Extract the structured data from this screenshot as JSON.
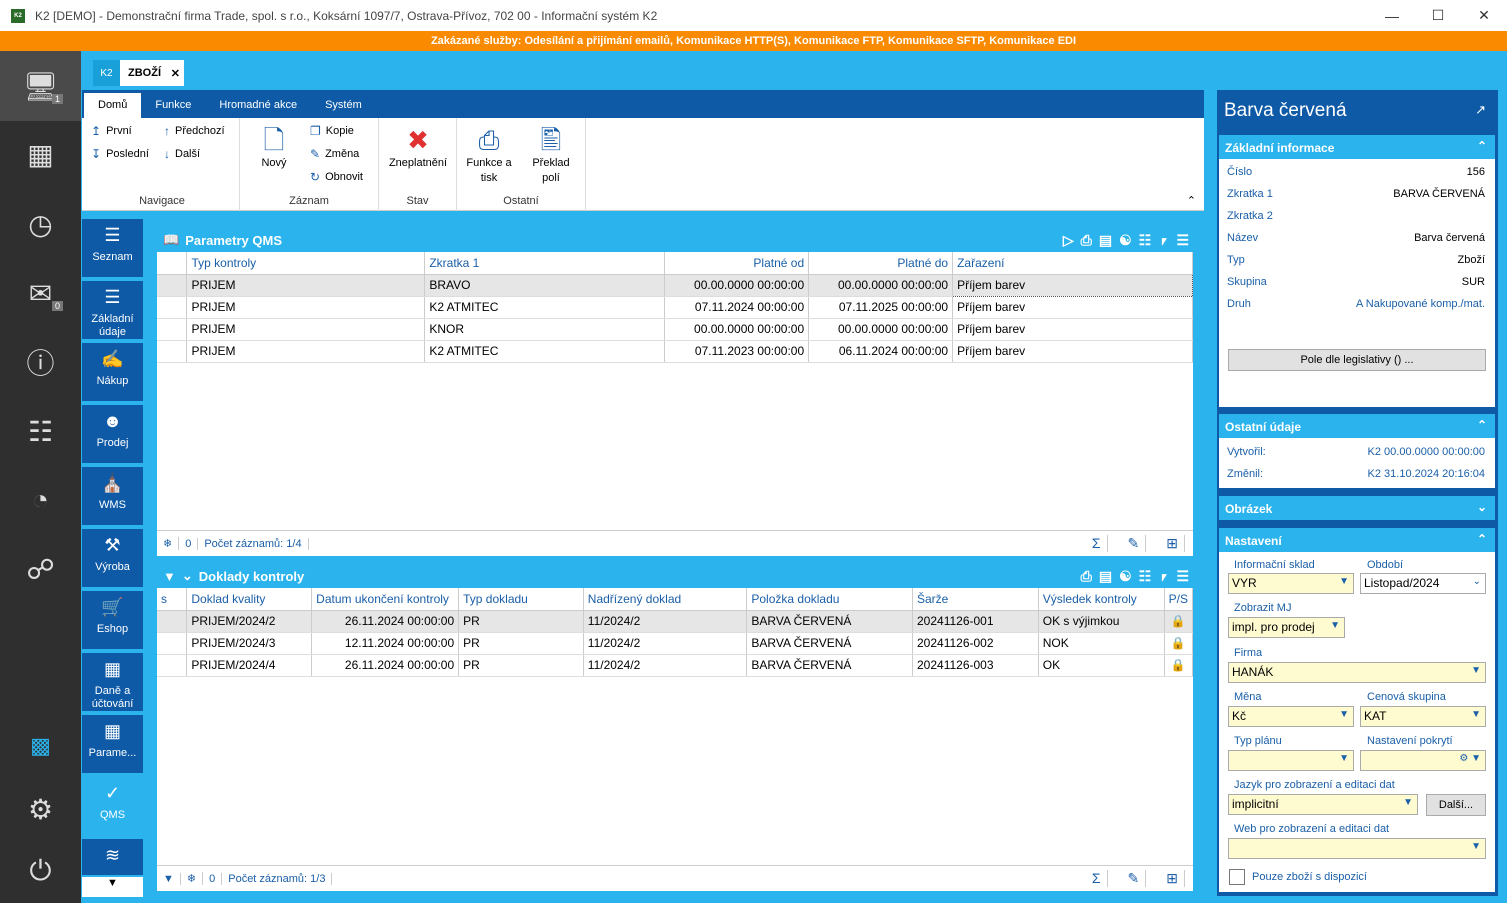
{
  "window": {
    "title": "K2 [DEMO] - Demonstrační firma Trade, spol. s r.o., Koksární 1097/7, Ostrava-Přívoz, 702 00 - Informační systém K2",
    "app_icon": "K2"
  },
  "banner": "Zakázané služby: Odesílání a přijímání emailů, Komunikace HTTP(S), Komunikace FTP, Komunikace SFTP, Komunikace EDI",
  "leftbar": {
    "desktop_badge": "1",
    "messages_badge": "0"
  },
  "tabs": {
    "k2": "K2",
    "active": "ZBOŽÍ"
  },
  "menu": [
    "Domů",
    "Funkce",
    "Hromadné akce",
    "Systém"
  ],
  "ribbon": {
    "nav": {
      "first": "První",
      "prev": "Předchozí",
      "last": "Poslední",
      "next": "Další",
      "label": "Navigace"
    },
    "record": {
      "new": "Nový",
      "copy": "Kopie",
      "change": "Změna",
      "refresh": "Obnovit",
      "label": "Záznam"
    },
    "state": {
      "cancel": "Zneplatnění",
      "label": "Stav"
    },
    "other": {
      "print_line1": "Funkce a",
      "print_line2": "tisk",
      "translate_line1": "Překlad",
      "translate_line2": "polí",
      "label": "Ostatní"
    }
  },
  "modules": [
    "Seznam",
    "Základní údaje",
    "Nákup",
    "Prodej",
    "WMS",
    "Výroba",
    "Eshop",
    "Daně a účtování",
    "Parame...",
    "QMS"
  ],
  "qms": {
    "title": "Parametry QMS",
    "columns": [
      "Typ kontroly",
      "Zkratka 1",
      "Platné od",
      "Platné do",
      "Zařazení"
    ],
    "rows": [
      [
        "PRIJEM",
        "BRAVO",
        "00.00.0000 00:00:00",
        "00.00.0000 00:00:00",
        "Příjem barev"
      ],
      [
        "PRIJEM",
        "K2 ATMITEC",
        "07.11.2024 00:00:00",
        "07.11.2025 00:00:00",
        "Příjem barev"
      ],
      [
        "PRIJEM",
        "KNOR",
        "00.00.0000 00:00:00",
        "00.00.0000 00:00:00",
        "Příjem barev"
      ],
      [
        "PRIJEM",
        "K2 ATMITEC",
        "07.11.2023 00:00:00",
        "06.11.2024 00:00:00",
        "Příjem barev"
      ]
    ],
    "footer_count": "0",
    "footer_records": "Počet záznamů: 1/4"
  },
  "docs": {
    "title": "Doklady kontroly",
    "columns": [
      "s",
      "Doklad kvality",
      "Datum ukončení kontroly",
      "Typ dokladu",
      "Nadřízený doklad",
      "Položka dokladu",
      "Šarže",
      "Výsledek kontroly",
      "P/S"
    ],
    "rows": [
      [
        "",
        "PRIJEM/2024/2",
        "26.11.2024 00:00:00",
        "PR",
        "11/2024/2",
        "BARVA ČERVENÁ",
        "20241126-001",
        "OK s výjimkou"
      ],
      [
        "",
        "PRIJEM/2024/3",
        "12.11.2024 00:00:00",
        "PR",
        "11/2024/2",
        "BARVA ČERVENÁ",
        "20241126-002",
        "NOK"
      ],
      [
        "",
        "PRIJEM/2024/4",
        "26.11.2024 00:00:00",
        "PR",
        "11/2024/2",
        "BARVA ČERVENÁ",
        "20241126-003",
        "OK"
      ]
    ],
    "footer_count": "0",
    "footer_records": "Počet záznamů: 1/3"
  },
  "detail": {
    "title": "Barva červená",
    "basic": {
      "header": "Základní informace",
      "fields": [
        [
          "Číslo",
          "156"
        ],
        [
          "Zkratka 1",
          "BARVA ČERVENÁ"
        ],
        [
          "Zkratka 2",
          ""
        ],
        [
          "Název",
          "Barva červená"
        ],
        [
          "Typ",
          "Zboží"
        ],
        [
          "Skupina",
          "SUR"
        ],
        [
          "Druh",
          "A Nakupované komp./mat."
        ]
      ],
      "button": "Pole dle legislativy () ..."
    },
    "other": {
      "header": "Ostatní údaje",
      "created_label": "Vytvořil:",
      "created_value": "K2 00.00.0000 00:00:00",
      "changed_label": "Změnil:",
      "changed_value": "K2 31.10.2024 20:16:04"
    },
    "image": {
      "header": "Obrázek"
    },
    "settings": {
      "header": "Nastavení",
      "info_store_label": "Informační sklad",
      "info_store": "VYR",
      "period_label": "Období",
      "period": "Listopad/2024",
      "mj_label": "Zobrazit MJ",
      "mj": "impl. pro prodej",
      "firm_label": "Firma",
      "firm": "HANÁK",
      "currency_label": "Měna",
      "currency": "Kč",
      "price_group_label": "Cenová skupina",
      "price_group": "KAT",
      "plan_label": "Typ plánu",
      "plan": "",
      "coverage_label": "Nastavení pokrytí",
      "coverage": "",
      "lang_label": "Jazyk pro zobrazení a editaci dat",
      "lang": "implicitní",
      "more_button": "Další...",
      "web_label": "Web pro zobrazení a editaci dat",
      "web": "",
      "available_label": "Pouze zboží s dispozicí"
    }
  }
}
